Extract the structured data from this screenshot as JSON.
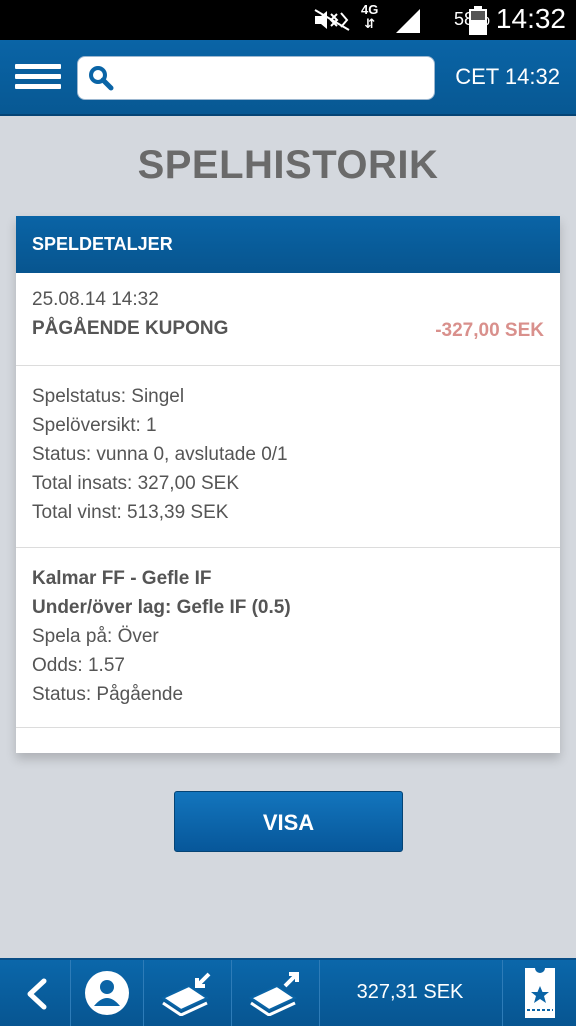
{
  "status_bar": {
    "network": "4G",
    "battery": "58%",
    "time": "14:32"
  },
  "header": {
    "search_placeholder": "",
    "clock": "CET 14:32"
  },
  "page_title": "SPELHISTORIK",
  "card": {
    "title": "SPELDETALJER",
    "date": "25.08.14 14:32",
    "coupon_label": "PÅGÅENDE KUPONG",
    "amount": "-327,00 SEK",
    "summary": {
      "spelstatus": "Spelstatus: Singel",
      "speloversikt": "Spelöversikt: 1",
      "status": "Status: vunna 0, avslutade 0/1",
      "total_insats": "Total insats: 327,00 SEK",
      "total_vinst": "Total vinst: 513,39 SEK"
    },
    "bet": {
      "match": "Kalmar FF - Gefle IF",
      "market": "Under/över lag: Gefle IF (0.5)",
      "play_on": "Spela på: Över",
      "odds": "Odds: 1.57",
      "status": "Status: Pågående"
    }
  },
  "visa_button": "VISA",
  "bottom_bar": {
    "balance": "327,31 SEK",
    "icons": [
      "back-icon",
      "user-icon",
      "deposit-icon",
      "withdraw-icon",
      "betslip-icon"
    ]
  },
  "colors": {
    "primary_blue": "#0a64a6",
    "negative_amount": "#d9908c",
    "background": "#d4d8de"
  }
}
